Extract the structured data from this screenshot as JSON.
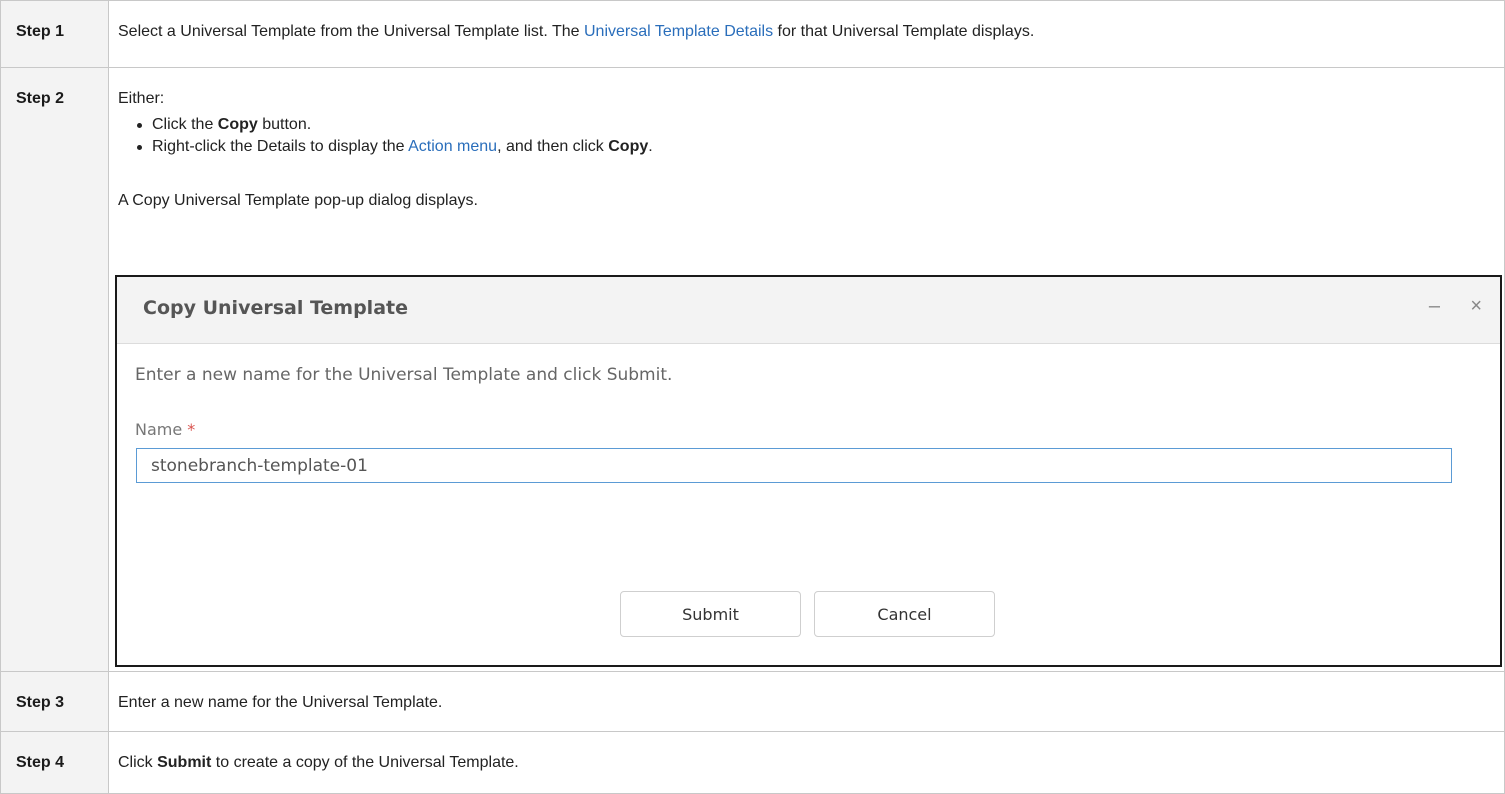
{
  "steps": [
    {
      "label": "Step 1",
      "parts": {
        "text_a": "Select a Universal Template from the Universal Template list. The ",
        "link": "Universal Template Details",
        "text_b": " for that Universal Template displays."
      }
    },
    {
      "label": "Step 2",
      "intro": "Either:",
      "bullet1": {
        "a": "Click the ",
        "bold": "Copy",
        "b": " button."
      },
      "bullet2": {
        "a": "Right-click the Details to display the ",
        "link": "Action menu",
        "b": ", and then click ",
        "bold": "Copy",
        "c": "."
      },
      "dialog_intro": "A Copy Universal Template pop-up dialog displays."
    },
    {
      "label": "Step 3",
      "text": "Enter a new name for the Universal Template."
    },
    {
      "label": "Step 4",
      "parts": {
        "a": "Click ",
        "bold": "Submit",
        "b": " to create a copy of the Universal Template."
      }
    }
  ],
  "dialog": {
    "title": "Copy Universal Template",
    "minimize_glyph": "–",
    "close_glyph": "×",
    "description": "Enter a new name for the Universal Template and click Submit.",
    "name_label": "Name",
    "required_mark": "*",
    "name_value": "stonebranch-template-01",
    "submit_label": "Submit",
    "cancel_label": "Cancel"
  },
  "colors": {
    "link": "#2a6ebb",
    "label_bg": "#f3f3f3",
    "input_border": "#5b9bd5",
    "required": "#d9534f"
  }
}
